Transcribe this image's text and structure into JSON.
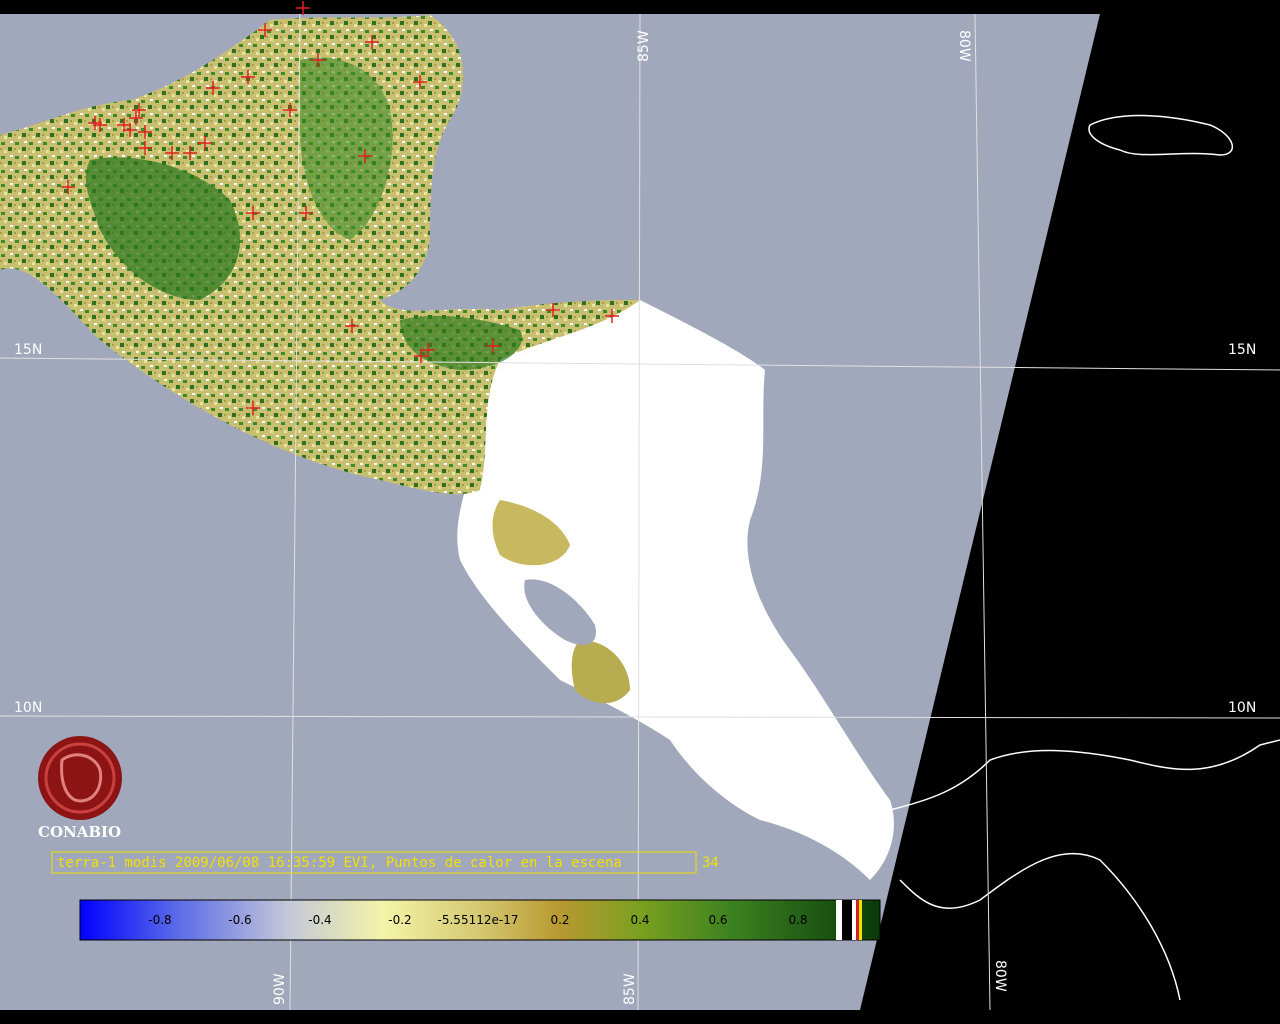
{
  "scene": {
    "caption": "terra-1 modis 2009/06/08 16:35:59 EVI, Puntos de calor en la escena",
    "hotspot_count": "34"
  },
  "logo": {
    "name": "CONABIO"
  },
  "graticule": {
    "lon_labels": {
      "w90": "90W",
      "w85": "85W",
      "w80": "80W"
    },
    "lat_labels": {
      "n15": "15N",
      "n10": "10N"
    }
  },
  "colorbar": {
    "tick_labels": [
      "-0.8",
      "-0.6",
      "-0.4",
      "-0.2",
      "-5.55112e-17",
      "0.2",
      "0.4",
      "0.6",
      "0.8"
    ]
  },
  "colors": {
    "ocean": "#a2a8bc",
    "night": "#000000",
    "cloud": "#ffffff",
    "veg_low": "#e8e4a0",
    "veg_mid": "#b8ac40",
    "veg_high": "#2f7a20",
    "hotspot": "#e02020",
    "caption": "#f0e000",
    "logo": "#8c1414"
  }
}
